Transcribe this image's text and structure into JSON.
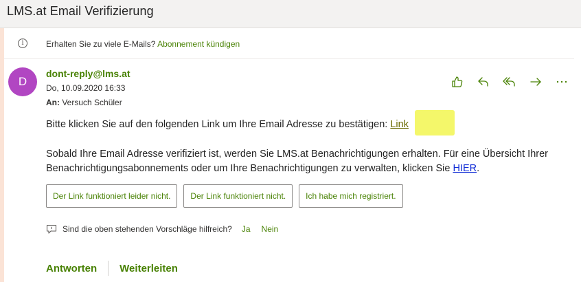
{
  "subject": "LMS.at Email Verifizierung",
  "info": {
    "text": "Erhalten Sie zu viele E-Mails?",
    "link": "Abonnement kündigen"
  },
  "sender": {
    "initial": "D",
    "email": "dont-reply@lms.at",
    "date": "Do, 10.09.2020 16:33",
    "to_label": "An:",
    "to_name": "Versuch Schüler"
  },
  "actions": [
    {
      "name": "like",
      "icon": "thumbs-up-icon"
    },
    {
      "name": "reply",
      "icon": "reply-icon"
    },
    {
      "name": "reply-all",
      "icon": "reply-all-icon"
    },
    {
      "name": "forward",
      "icon": "forward-icon"
    },
    {
      "name": "more",
      "icon": "more-icon"
    }
  ],
  "body": {
    "line1_text": "Bitte klicken Sie auf den folgenden Link um Ihre Email Adresse zu bestätigen:",
    "line1_link": "Link",
    "para_text": "Sobald Ihre Email Adresse verifiziert ist, werden Sie LMS.at Benachrichtigungen erhalten. Für eine Übersicht Ihrer Benachrichtigungsabonnements oder um Ihre Benachrichtigungen zu verwalten, klicken Sie",
    "para_link": "HIER",
    "para_end": "."
  },
  "suggestions": [
    "Der Link funktioniert leider nicht.",
    "Der Link funktioniert nicht.",
    "Ich habe mich registriert."
  ],
  "feedback": {
    "question": "Sind die oben stehenden Vorschläge hilfreich?",
    "yes": "Ja",
    "no": "Nein"
  },
  "reply": {
    "reply_label": "Antworten",
    "forward_label": "Weiterleiten"
  },
  "colors": {
    "accent": "#498205",
    "avatar": "#b146c2",
    "highlight": "#f4f76a",
    "hier_link": "#0f2bd6"
  }
}
